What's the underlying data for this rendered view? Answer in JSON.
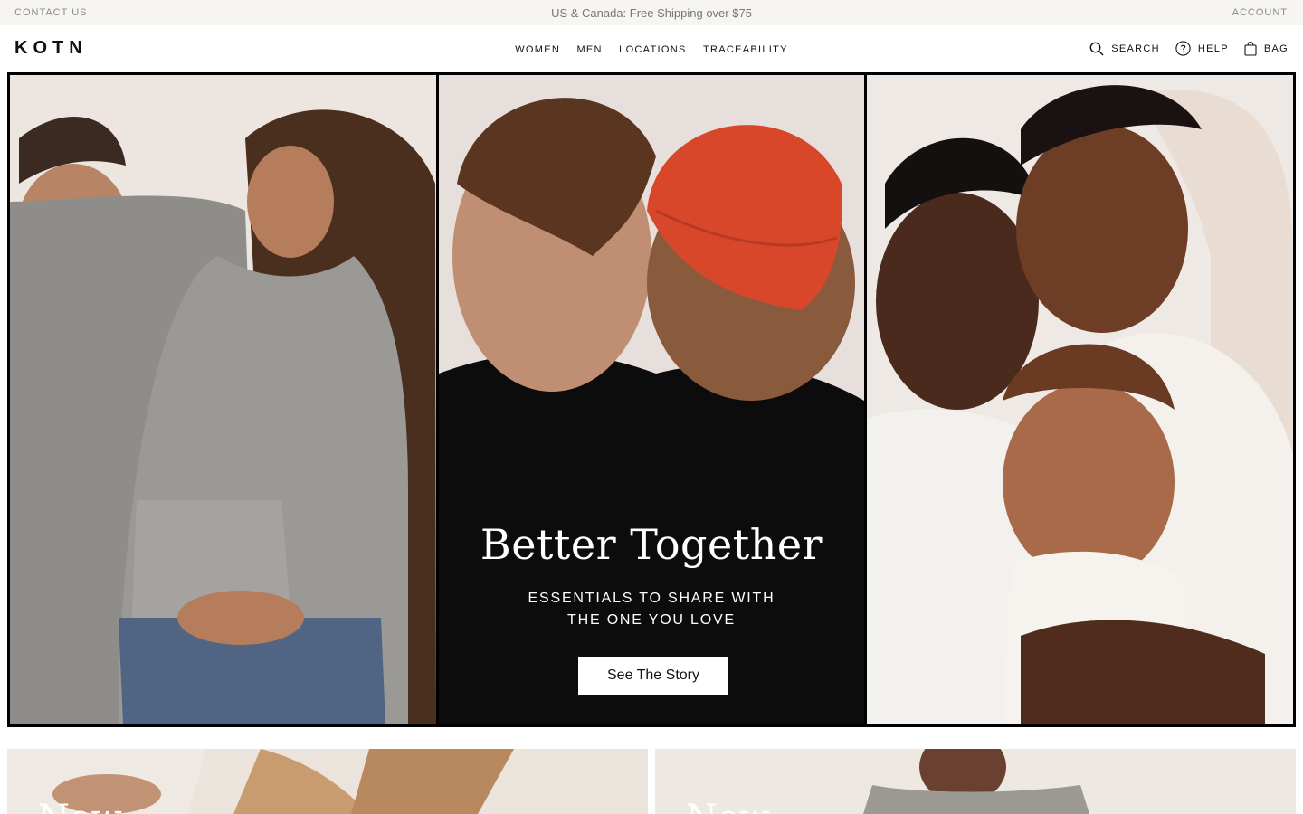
{
  "topbar": {
    "contact": "CONTACT US",
    "announcement": "US & Canada: Free Shipping over $75",
    "account": "ACCOUNT"
  },
  "nav": {
    "logo": "KOTN",
    "menu": [
      "WOMEN",
      "MEN",
      "LOCATIONS",
      "TRACEABILITY"
    ],
    "search": "SEARCH",
    "help": "HELP",
    "bag": "BAG"
  },
  "hero": {
    "title": "Better Together",
    "subtitle": "ESSENTIALS TO SHARE WITH THE ONE YOU LOVE",
    "cta": "See The Story"
  },
  "promos": [
    {
      "label": "New"
    },
    {
      "label": "New"
    }
  ],
  "colors": {
    "topbar_bg": "#f7f5f1",
    "hero_border": "#000000",
    "beanie": "#d9472b"
  }
}
